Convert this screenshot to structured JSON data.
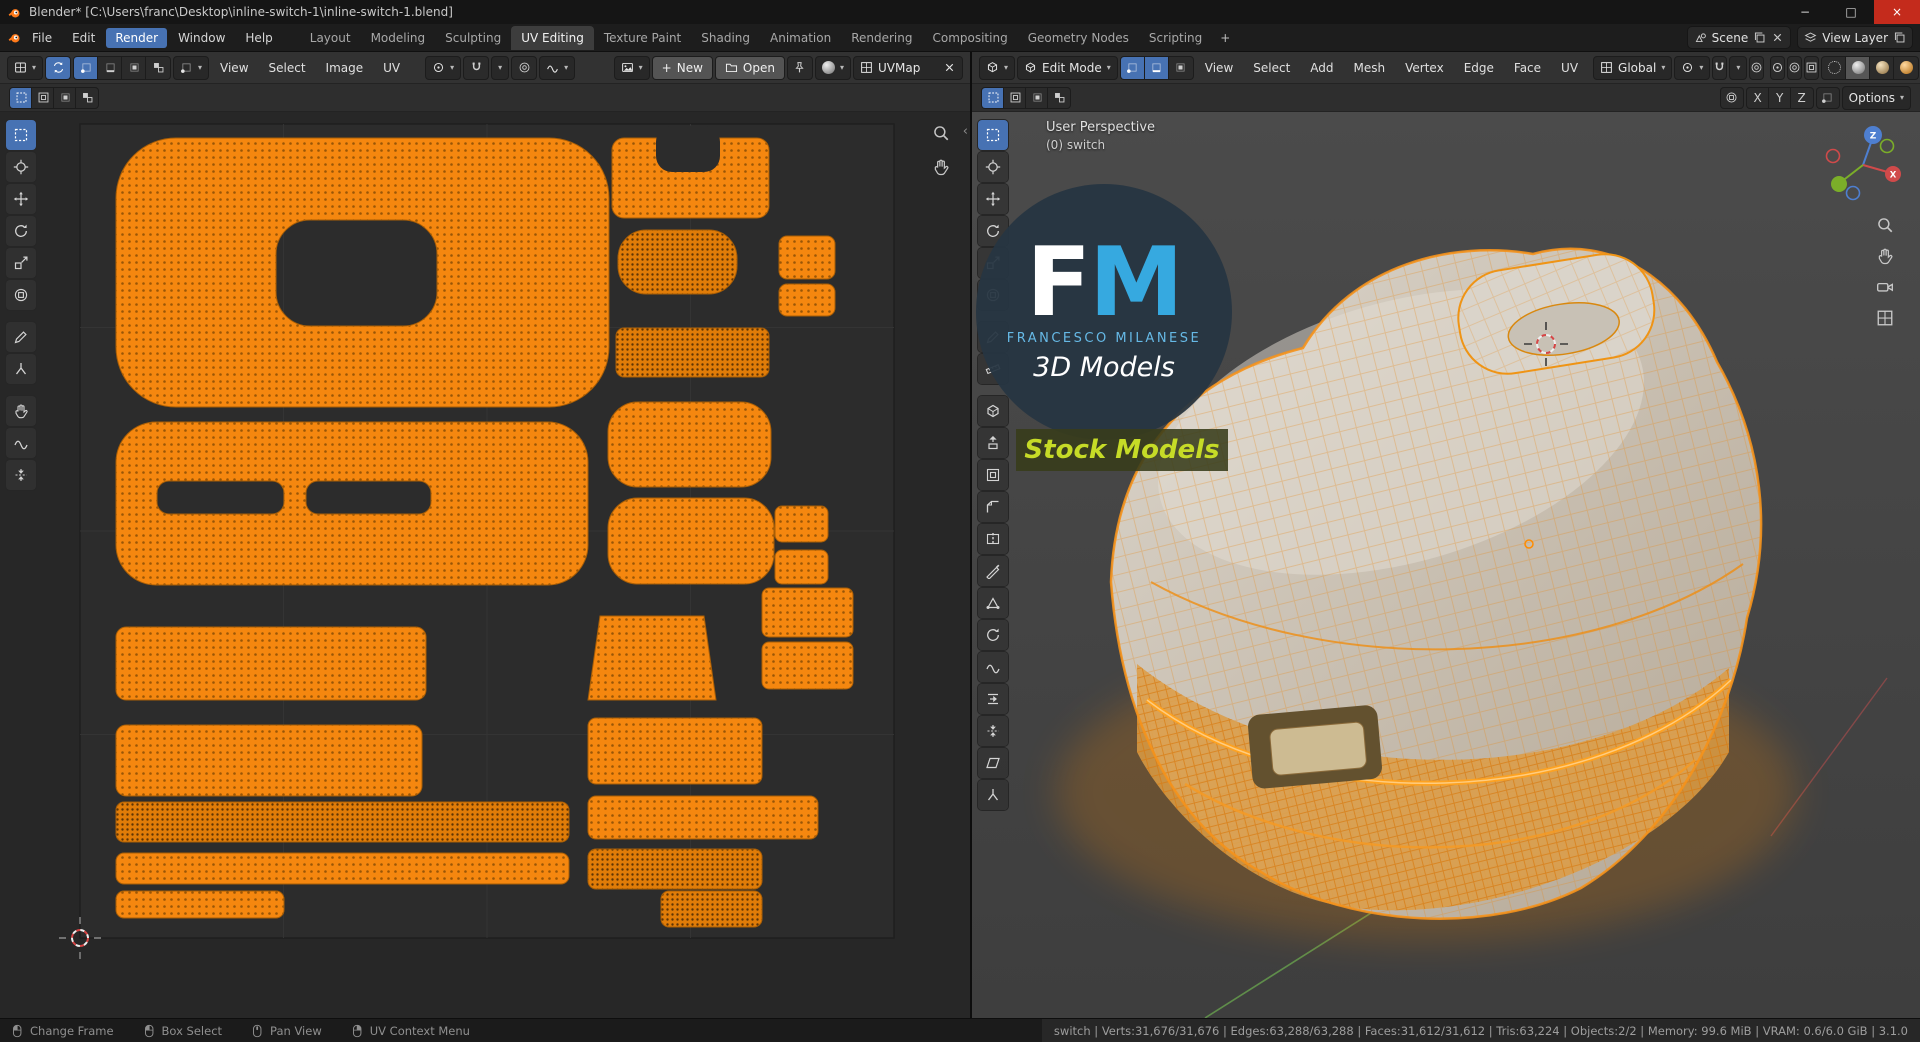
{
  "window": {
    "title": "Blender* [C:\\Users\\franc\\Desktop\\inline-switch-1\\inline-switch-1.blend]"
  },
  "colors": {
    "accent_blue": "#4772b3",
    "uv_island_orange": "#f5870f",
    "wireframe_orange": "#ff9a1c",
    "watermark_blue": "#36a9e0",
    "banner_green": "#c6db27",
    "close_button_red": "#c42b1c"
  },
  "icons": {
    "chevron": "▾",
    "collapse": "‹",
    "minimize": "−",
    "maximize": "□",
    "close": "×",
    "new_plus": "+"
  },
  "top_bar": {
    "menus": [
      "File",
      "Edit",
      "Render",
      "Window",
      "Help"
    ],
    "workspaces": [
      "Layout",
      "Modeling",
      "Sculpting",
      "UV Editing",
      "Texture Paint",
      "Shading",
      "Animation",
      "Rendering",
      "Compositing",
      "Geometry Nodes",
      "Scripting"
    ],
    "add_workspace_label": "+",
    "scene_label": "Scene",
    "view_layer_label": "View Layer"
  },
  "uv_editor": {
    "menus": [
      "View",
      "Select",
      "Image",
      "UV"
    ],
    "new_button_label": "New",
    "open_button_label": "Open",
    "uv_map_name": "UVMap"
  },
  "viewport_3d": {
    "mode_label": "Edit Mode",
    "menus": [
      "View",
      "Select",
      "Add",
      "Mesh",
      "Vertex",
      "Edge",
      "Face",
      "UV"
    ],
    "orientation_label": "Global",
    "options_label": "Options",
    "mirror_axes": [
      "X",
      "Y",
      "Z"
    ],
    "overlay_line1": "User Perspective",
    "overlay_line2": "(0) switch",
    "gizmo_z": "Z",
    "gizmo_x": "X"
  },
  "watermark": {
    "initial_f": "F",
    "initial_m": "M",
    "author_line": "FRANCESCO MILANESE",
    "tagline": "3D Models",
    "banner": "Stock Models"
  },
  "status_bar": {
    "hints": [
      "Change Frame",
      "Box Select",
      "Pan View",
      "UV Context Menu"
    ],
    "stats": "switch | Verts:31,676/31,676 | Edges:63,288/63,288 | Faces:31,612/31,612 | Tris:63,224 | Objects:2/2 | Memory: 99.6 MiB | VRAM: 0.6/6.0 GiB | 3.1.0"
  }
}
